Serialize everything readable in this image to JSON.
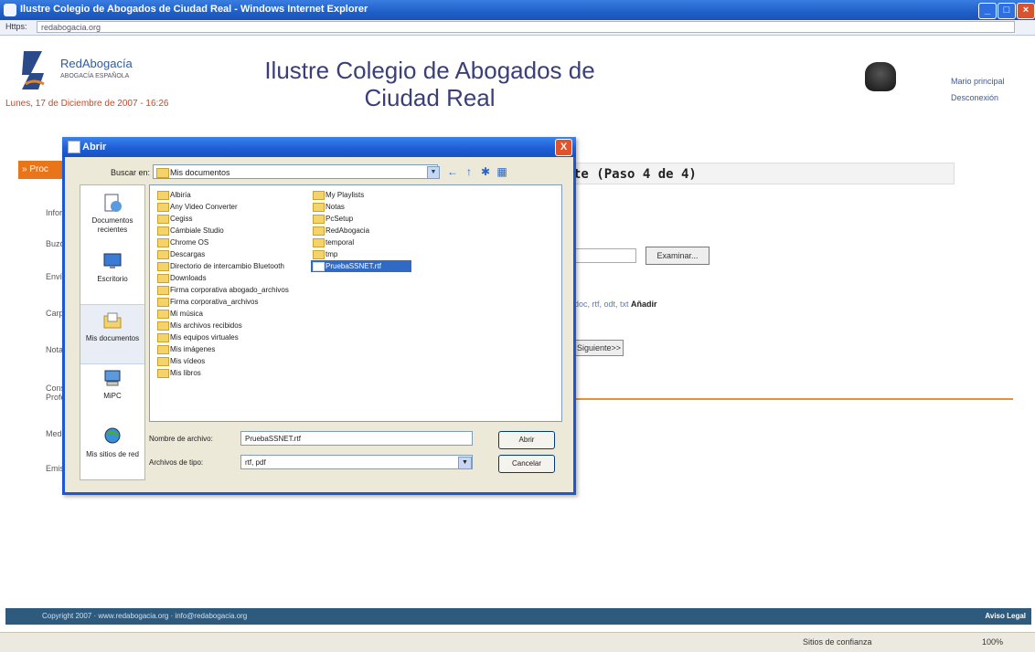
{
  "window": {
    "title": "Ilustre Colegio de Abogados de Ciudad Real - Windows Internet Explorer",
    "address_label": "Https:",
    "address_url": "redabogacia.org"
  },
  "page": {
    "logo_name": "RedAbogacía",
    "logo_sub": "ABOGACÍA ESPAÑOLA",
    "date": "Lunes, 17 de Diciembre de 2007 - 16:26",
    "title": "Ilustre Colegio de Abogados de Ciudad Real",
    "user_name": "Mario principal",
    "logout": "Desconexión",
    "step_tab": "» Proc",
    "step_heading": "te (Paso 4 de 4)",
    "side_labels": [
      "Inform",
      "Buzón",
      "Envío",
      "Carpe",
      "Notas",
      "Cons. Profes",
      "Medio",
      "Emisi"
    ],
    "examine_button": "Examinar...",
    "formats_text": "doc, rtf, odt, txt",
    "formats_add": "Añadir",
    "submit_button": "Siguiente>>",
    "footer_text": "Copyright 2007 · www.redabogacia.org · info@redabogacia.org",
    "footer_right": "Aviso Legal",
    "status_trust": "Sitios de confianza",
    "status_zoom": "100%"
  },
  "dialog": {
    "title": "Abrir",
    "close": "X",
    "look_in_label": "Buscar en:",
    "look_in_value": "Mis documentos",
    "toolbar": [
      "←",
      "↑",
      "✱",
      "▦"
    ],
    "places": [
      {
        "label": "Documentos recientes",
        "icon": "recent-docs-icon"
      },
      {
        "label": "Escritorio",
        "icon": "desktop-icon"
      },
      {
        "label": "Mis documentos",
        "icon": "my-documents-icon"
      },
      {
        "label": "MiPC",
        "icon": "my-computer-icon"
      },
      {
        "label": "Mis sitios de red",
        "icon": "network-icon"
      }
    ],
    "files_col1": [
      "Albiría",
      "Any Video Converter",
      "Cegiss",
      "Cámbiale Studio",
      "Chrome OS",
      "Descargas",
      "Directorio de intercambio Bluetooth",
      "Downloads",
      "Firma corporativa abogado_archivos",
      "Firma corporativa_archivos",
      "Mi música",
      "Mis archivos recibidos",
      "Mis equipos virtuales",
      "Mis imágenes",
      "Mis vídeos",
      "Mis libros"
    ],
    "files_col2": [
      "My Playlists",
      "Notas",
      "PcSetup",
      "RedAbogacia",
      "temporal",
      "tmp",
      "PruebaSSNET.rtf"
    ],
    "selected_file": "PruebaSSNET.rtf",
    "filename_label": "Nombre de archivo:",
    "filename_value": "PruebaSSNET.rtf",
    "filetype_label": "Archivos de tipo:",
    "filetype_value": "rtf, pdf",
    "open_button": "Abrir",
    "cancel_button": "Cancelar"
  }
}
